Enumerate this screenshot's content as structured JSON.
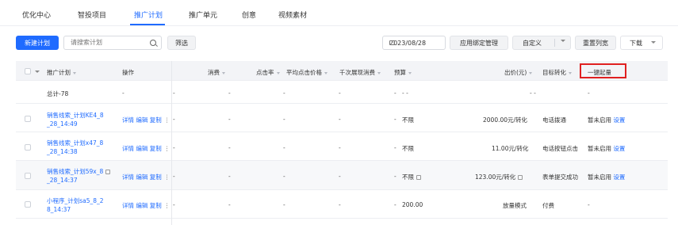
{
  "tabs": [
    "优化中心",
    "智投项目",
    "推广计划",
    "推广单元",
    "创意",
    "视频素材"
  ],
  "toolbar": {
    "new_plan": "新建计划",
    "search_placeholder": "请搜索计划",
    "filter": "筛选",
    "date": "2023/08/28",
    "app_binding": "应用绑定管理",
    "custom": "自定义",
    "reset_columns": "重置列宽",
    "download": "下载"
  },
  "columns": {
    "plan": "推广计划",
    "action": "操作",
    "cost": "消费",
    "ctr": "点击率",
    "avg_click_price": "平均点击价格",
    "cpm": "千次展现消费",
    "budget": "预算",
    "bid": "出价(元)",
    "target": "目标转化",
    "boost": "一键起量"
  },
  "summary": {
    "label": "总计-78",
    "action": "-",
    "cost": "-",
    "ctr": "-",
    "avg": "-",
    "cpm": "-",
    "budget": "- -",
    "bid": "- -",
    "boost": "-"
  },
  "rows": [
    {
      "name1": "销售线索_计划KE4_8",
      "name2": "_28_14:49",
      "actions": "详情 编辑 复制",
      "budget_prefix": "-",
      "budget": "不限",
      "bid": "2000.00元/转化",
      "target": "电话拨通",
      "boost_status": "暂未启用",
      "boost_link": "设置"
    },
    {
      "name1": "销售线索_计划x47_8",
      "name2": "_28_14:38",
      "actions": "详情 编辑 复制",
      "budget_prefix": "-",
      "budget": "不限",
      "bid": "11.00元/转化",
      "target": "电话按钮点击",
      "boost_status": "暂未启用",
      "boost_link": "设置"
    },
    {
      "name1": "销售线索_计划59x_8",
      "name2": "_28_14:37",
      "actions": "详情 编辑 复制",
      "budget_prefix": "-",
      "budget": "不限",
      "bid": "123.00元/转化",
      "target": "表单提交成功",
      "boost_status": "暂未启用",
      "boost_link": "设置"
    },
    {
      "name1": "小程序_计划sa5_8_2",
      "name2": "8_14:37",
      "actions": "详情 编辑 复制",
      "budget_prefix": "-",
      "budget": "200.00",
      "bid": "放量模式",
      "target": "付费",
      "boost_status": "-",
      "boost_link": ""
    }
  ],
  "placeholders": {
    "dash": "-"
  },
  "colors": {
    "accent": "#1f6bff",
    "highlight": "#e02020"
  }
}
